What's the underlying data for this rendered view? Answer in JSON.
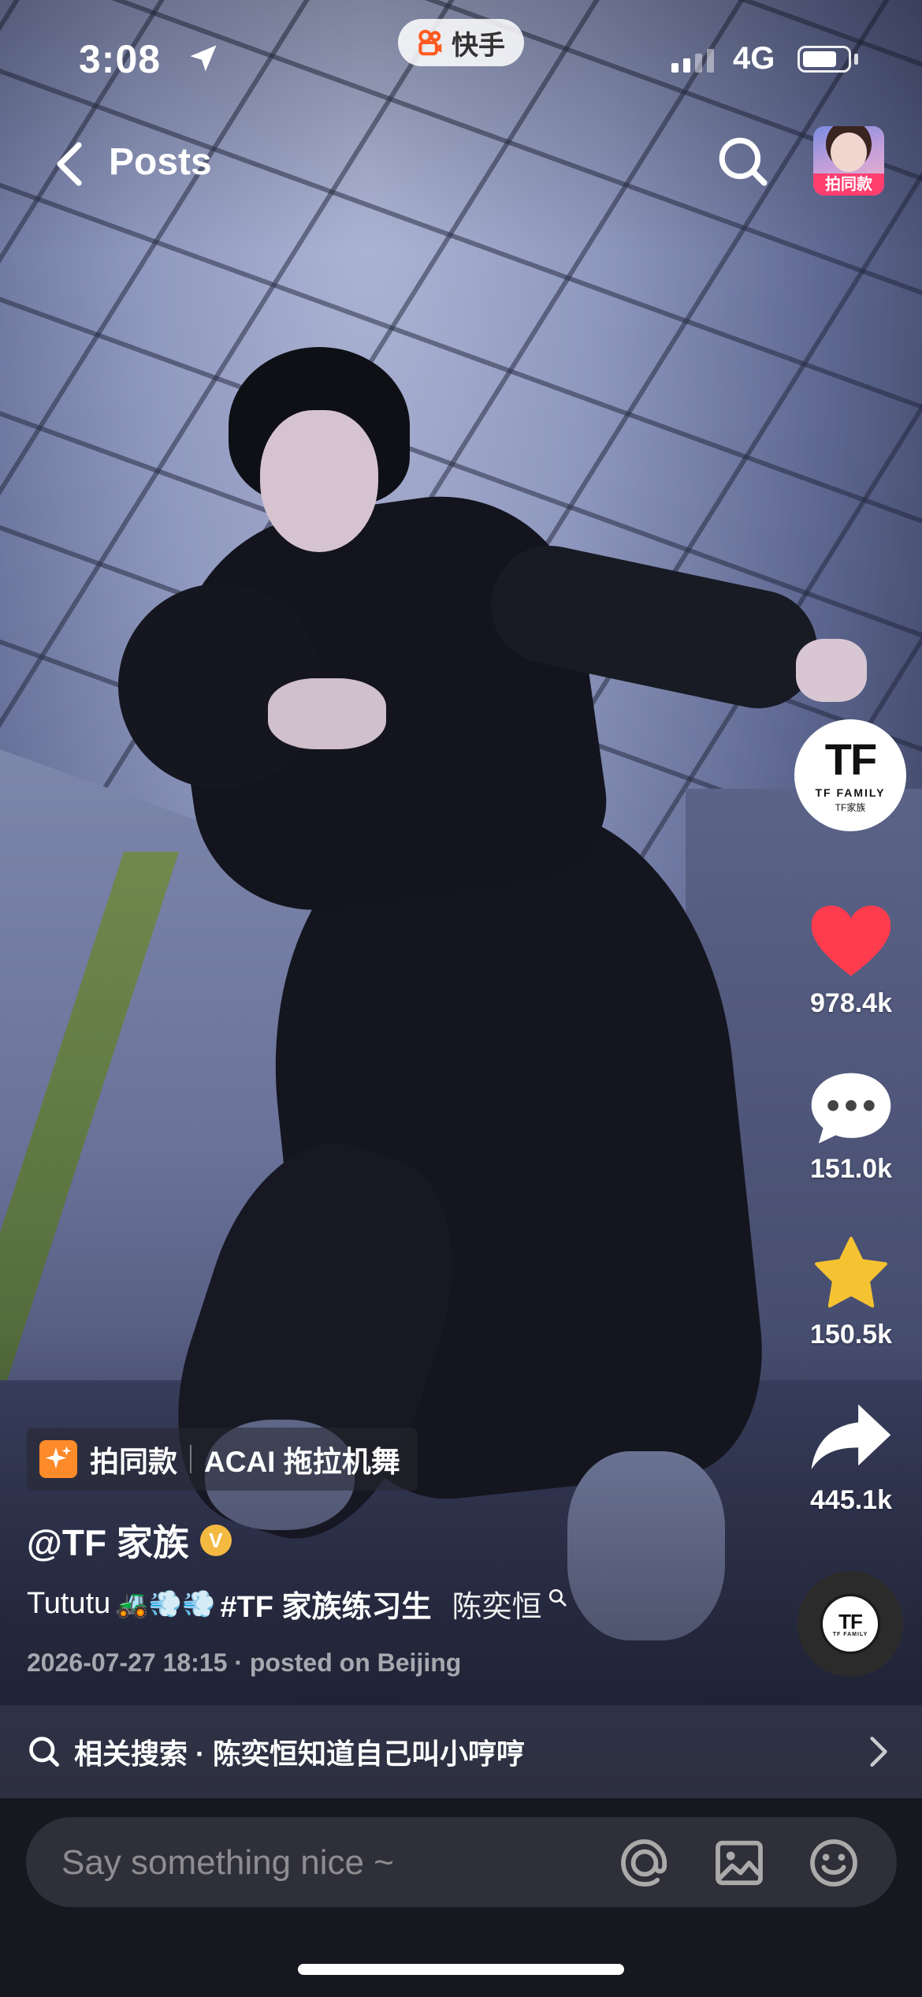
{
  "status_bar": {
    "time": "3:08",
    "network": "4G",
    "battery_level": 0.78,
    "app_pill": "快手"
  },
  "nav": {
    "title": "Posts",
    "same_style_label": "拍同款"
  },
  "rail": {
    "avatar": {
      "logo_text": "TF",
      "brand": "TF FAMILY",
      "sub": "TF家族"
    },
    "likes": "978.4k",
    "comments": "151.0k",
    "favorites": "150.5k",
    "shares": "445.1k",
    "music_logo": "TF"
  },
  "caption": {
    "template_label": "拍同款",
    "template_name": "ACAI 拖拉机舞",
    "author": "@TF 家族",
    "verified_badge": "V",
    "text_prefix": "Tututu",
    "emojis": "🚜💨💨",
    "hashtag": "#TF 家族练习生",
    "mention": "陈奕恒",
    "meta": "2026-07-27 18:15 · posted on Beijing"
  },
  "related": {
    "text": "相关搜索 · 陈奕恒知道自己叫小哼哼"
  },
  "comment_input": {
    "placeholder": "Say something nice ~"
  },
  "colors": {
    "like": "#ff3b4e",
    "favorite": "#f5c332",
    "template_icon": "#ff8a2a",
    "verified": "#f4b940",
    "same_style_tag": "#ff3d6e"
  }
}
